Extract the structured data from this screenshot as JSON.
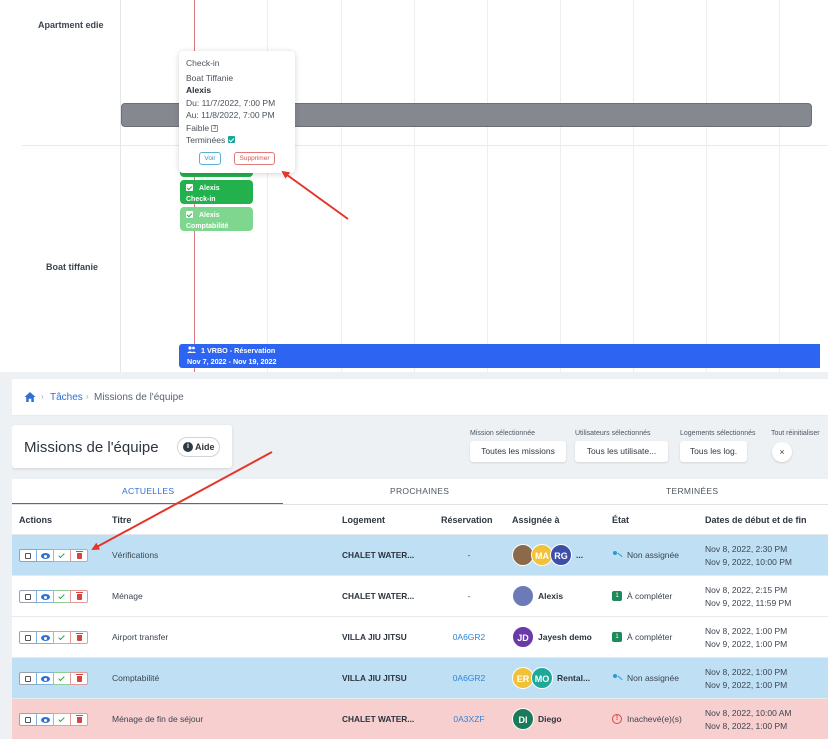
{
  "calendar": {
    "rows": [
      {
        "label": "Apartment edie"
      },
      {
        "label": "Boat tiffanie"
      }
    ],
    "popup": {
      "title": "Check-in",
      "property": "Boat Tiffanie",
      "assignee": "Alexis",
      "from": "Du: 11/7/2022, 7:00 PM",
      "to": "Au: 11/8/2022, 7:00 PM",
      "priority": "Faible",
      "priority_badge": "3",
      "status": "Terminées",
      "view_button": "Voir",
      "delete_button": "Supprimer"
    },
    "chips": [
      {
        "name": "Alexis",
        "task": "Check-in",
        "color": "#23b14d"
      },
      {
        "name": "Alexis",
        "task": "Comptabilité",
        "color": "#7fd78f"
      }
    ],
    "reservation_bar": {
      "line1": "1 VRBO - Réservation",
      "line2": "Nov 7, 2022 - Nov 19, 2022",
      "color": "#2e64f2"
    }
  },
  "breadcrumb": {
    "items": [
      "Tâches",
      "Missions de l'équipe"
    ]
  },
  "page": {
    "title": "Missions de l'équipe",
    "help_label": "Aide"
  },
  "filters": [
    {
      "label": "Mission sélectionnée",
      "value": "Toutes les missions"
    },
    {
      "label": "Utilisateurs sélectionnés",
      "value": "Tous les utilisate..."
    },
    {
      "label": "Logements sélectionnés",
      "value": "Tous les log."
    }
  ],
  "reset": {
    "label": "Tout réinitialiser",
    "button": "×"
  },
  "tabs": [
    {
      "label": "ACTUELLES",
      "active": true
    },
    {
      "label": "PROCHAINES",
      "active": false
    },
    {
      "label": "TERMINÉES",
      "active": false
    }
  ],
  "table": {
    "headers": {
      "actions": "Actions",
      "title": "Titre",
      "logement": "Logement",
      "reservation": "Réservation",
      "assignee": "Assignée à",
      "state": "État",
      "dates": "Dates de début et de fin"
    },
    "rows": [
      {
        "title": "Vérifications",
        "logement": "CHALET WATER...",
        "reservation": "-",
        "avatars": [
          {
            "initials": "",
            "color": "#8a6a4a"
          },
          {
            "initials": "MA",
            "color": "#f2c13a"
          },
          {
            "initials": "RG",
            "color": "#3c4fa8"
          }
        ],
        "assignee_name": "...",
        "state": "Non assignée",
        "state_type": "unassigned",
        "start": "Nov 8, 2022, 2:30 PM",
        "end": "Nov 9, 2022, 10:00 PM",
        "bg": "#bfe0f4"
      },
      {
        "title": "Ménage",
        "logement": "CHALET WATER...",
        "reservation": "-",
        "avatars": [
          {
            "initials": "",
            "color": "#6d7ab8"
          }
        ],
        "assignee_name": "Alexis",
        "state": "À compléter",
        "state_type": "todo",
        "start": "Nov 8, 2022, 2:15 PM",
        "end": "Nov 9, 2022, 11:59 PM",
        "bg": "#ffffff"
      },
      {
        "title": "Airport transfer",
        "logement": "VILLA JIU JITSU",
        "reservation": "0A6GR2",
        "avatars": [
          {
            "initials": "JD",
            "color": "#6a3aa8"
          }
        ],
        "assignee_name": "Jayesh demo",
        "state": "À compléter",
        "state_type": "todo",
        "start": "Nov 8, 2022, 1:00 PM",
        "end": "Nov 9, 2022, 1:00 PM",
        "bg": "#ffffff"
      },
      {
        "title": "Comptabilité",
        "logement": "VILLA JIU JITSU",
        "reservation": "0A6GR2",
        "avatars": [
          {
            "initials": "ER",
            "color": "#f2c13a"
          },
          {
            "initials": "MO",
            "color": "#1ea89a"
          }
        ],
        "assignee_name": "Rental...",
        "state": "Non assignée",
        "state_type": "unassigned",
        "start": "Nov 8, 2022, 1:00 PM",
        "end": "Nov 9, 2022, 1:00 PM",
        "bg": "#bfe0f4"
      },
      {
        "title": "Ménage de fin de séjour",
        "logement": "CHALET WATER...",
        "reservation": "0A3XZF",
        "avatars": [
          {
            "initials": "DI",
            "color": "#1b7a5a"
          }
        ],
        "assignee_name": "Diego",
        "state": "Inachevé(e)(s)",
        "state_type": "overdue",
        "start": "Nov 8, 2022, 10:00 AM",
        "end": "Nov 8, 2022, 1:00 PM",
        "bg": "#f8cfcf"
      }
    ]
  },
  "colors": {
    "accent": "#2f6fd6",
    "today_line": "#d9797c",
    "annotation_arrow": "#e4352a"
  }
}
